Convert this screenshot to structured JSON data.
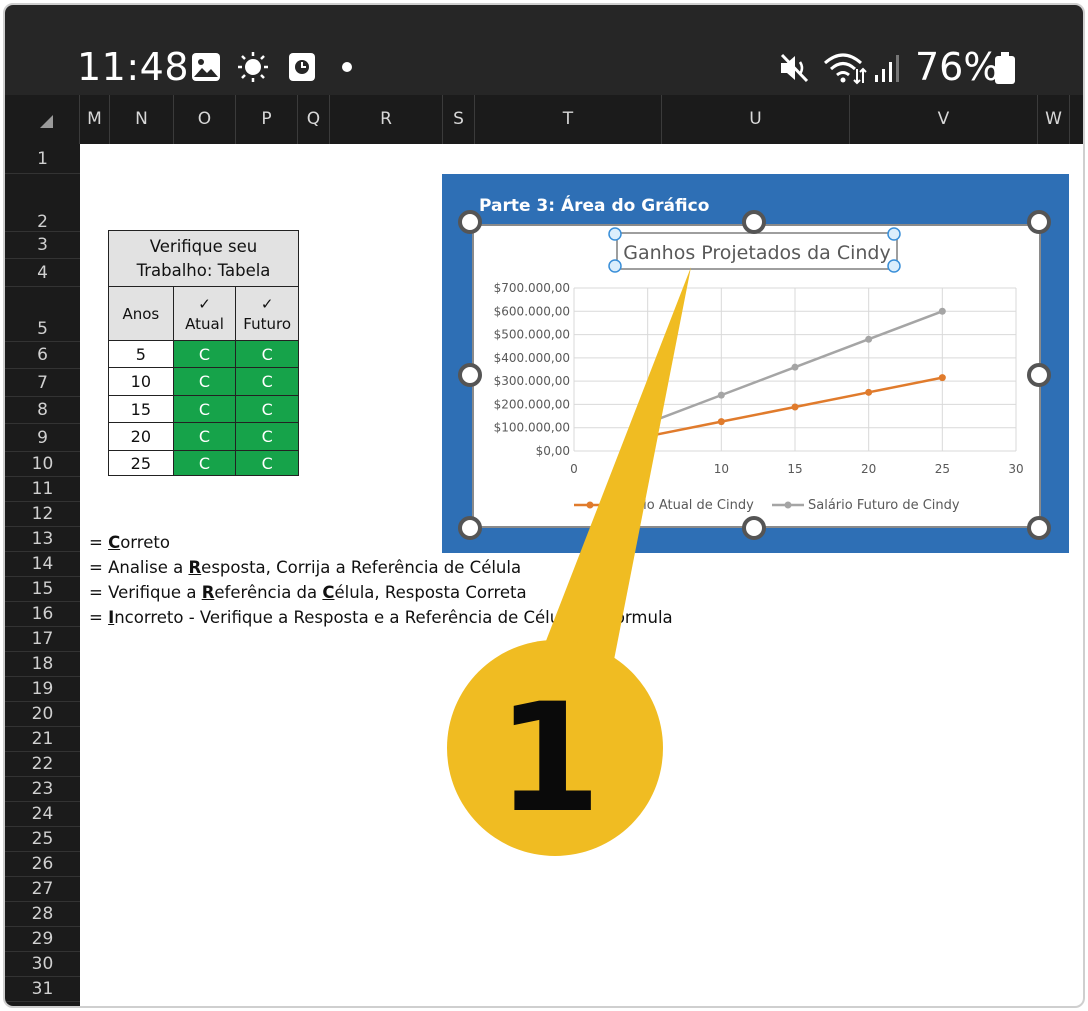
{
  "status_bar": {
    "time": "11:48",
    "battery_percent": "76%",
    "icons": [
      "image-icon",
      "brightness-icon",
      "clock-icon",
      "dot-icon",
      "mute-icon",
      "wifi-icon",
      "signal-icon",
      "battery-icon"
    ]
  },
  "sheet": {
    "columns": [
      "M",
      "N",
      "O",
      "P",
      "Q",
      "R",
      "S",
      "T",
      "U",
      "V",
      "W"
    ],
    "rows": [
      "1",
      "2",
      "3",
      "4",
      "5",
      "6",
      "7",
      "8",
      "9",
      "10",
      "11",
      "12",
      "13",
      "14",
      "15",
      "16",
      "17",
      "18",
      "19",
      "20",
      "21",
      "22",
      "23",
      "24",
      "25",
      "26",
      "27",
      "28",
      "29",
      "30",
      "31"
    ]
  },
  "check_table": {
    "title_line1": "Verifique seu",
    "title_line2": "Trabalho: Tabela",
    "col_anos": "Anos",
    "check_mark": "✓",
    "col_atual": "Atual",
    "col_futuro": "Futuro",
    "rows": [
      {
        "anos": "5",
        "atual": "C",
        "futuro": "C"
      },
      {
        "anos": "10",
        "atual": "C",
        "futuro": "C"
      },
      {
        "anos": "15",
        "atual": "C",
        "futuro": "C"
      },
      {
        "anos": "20",
        "atual": "C",
        "futuro": "C"
      },
      {
        "anos": "25",
        "atual": "C",
        "futuro": "C"
      }
    ]
  },
  "legend": {
    "l1_pre": "= ",
    "l1_u": "C",
    "l1_post": "orreto",
    "l2_pre": "= Analise a ",
    "l2_u": "R",
    "l2_post": "esposta, Corrija a Referência de Célula",
    "l3_pre": "= Verifique a ",
    "l3_u": "R",
    "l3_mid": "eferência da ",
    "l3_u2": "C",
    "l3_post": "élula, Resposta Correta",
    "l4_pre": "= ",
    "l4_u": "I",
    "l4_post": "ncorreto - Verifique a Resposta e a Referência de Célula on Formula"
  },
  "chart_panel": {
    "label": "Parte 3: Área do Gráfico"
  },
  "callout": {
    "number": "1",
    "color": "#f0bc22"
  },
  "chart_data": {
    "type": "line",
    "title": "Ganhos Projetados da Cindy",
    "x": [
      5,
      10,
      15,
      20,
      25
    ],
    "xlim": [
      0,
      30
    ],
    "x_ticks": [
      "0",
      "10",
      "15",
      "20",
      "25",
      "30"
    ],
    "ylim": [
      0,
      700000
    ],
    "y_ticks": [
      "$0,00",
      "$100.000,00",
      "$200.000,00",
      "$300.000,00",
      "$400.000,00",
      "$500.000,00",
      "$600.000,00",
      "$700.000,00"
    ],
    "grid": true,
    "legend_position": "bottom",
    "series": [
      {
        "name": "Salário Atual de Cindy",
        "color": "#e07b2c",
        "values": [
          63000,
          126000,
          189000,
          252000,
          315000
        ]
      },
      {
        "name": "Salário Futuro de Cindy",
        "color": "#a5a5a5",
        "values": [
          120000,
          240000,
          360000,
          480000,
          600000
        ]
      }
    ]
  }
}
